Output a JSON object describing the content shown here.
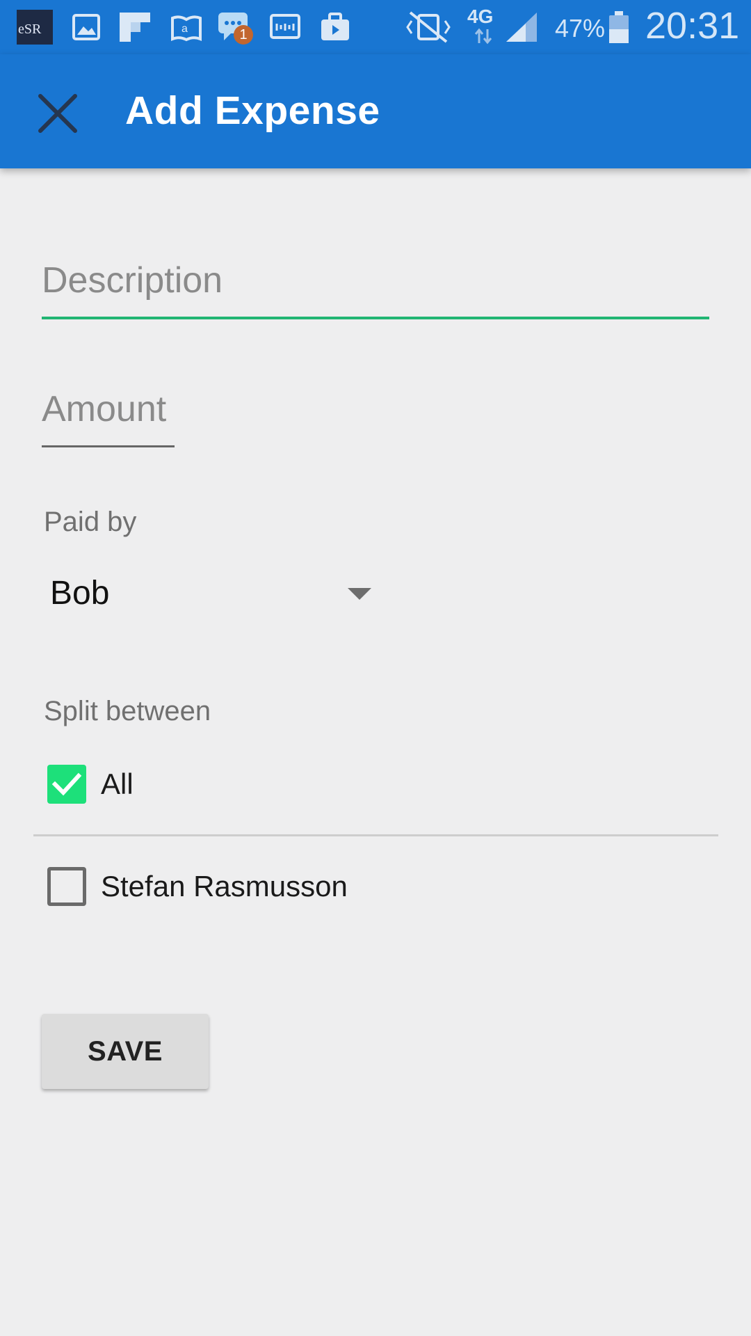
{
  "status_bar": {
    "network": "4G",
    "battery": "47%",
    "time": "20:31",
    "notification_badge": "1",
    "icons": [
      "app-logo-icon",
      "gallery-icon",
      "flipboard-icon",
      "amazon-kindle-icon",
      "messages-icon",
      "tv-icon",
      "briefcase-icon",
      "vibrate-mute-icon",
      "data-arrows-icon",
      "signal-icon",
      "battery-icon"
    ]
  },
  "app_bar": {
    "title": "Add Expense",
    "close_icon": "close-icon",
    "color": "#1976d2"
  },
  "form": {
    "description": {
      "value": "",
      "placeholder": "Description"
    },
    "amount": {
      "value": "",
      "placeholder": "Amount"
    },
    "paid_by_label": "Paid by",
    "paid_by_selected": "Bob",
    "split_label": "Split between",
    "split_options": [
      {
        "label": "All",
        "checked": true
      },
      {
        "label": "Stefan Rasmusson",
        "checked": false
      }
    ],
    "save_label": "SAVE",
    "accent_color": "#21b573",
    "checkbox_color": "#1de07a"
  }
}
